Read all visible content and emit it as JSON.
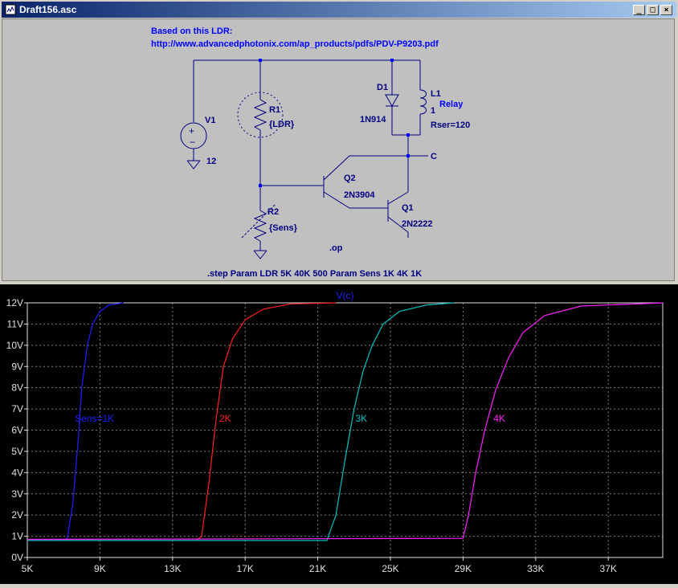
{
  "window": {
    "title": "Draft156.asc",
    "buttons": [
      "_",
      "□",
      "×"
    ]
  },
  "schematic": {
    "comment1": "Based on this LDR:",
    "comment2": "http://www.advancedphotonix.com/ap_products/pdfs/PDV-P9203.pdf",
    "v1": {
      "name": "V1",
      "value": "12"
    },
    "r1": {
      "name": "R1",
      "value": "{LDR}"
    },
    "r2": {
      "name": "R2",
      "value": "{Sens}"
    },
    "d1": {
      "name": "D1",
      "value": "1N914"
    },
    "l1": {
      "name": "L1",
      "value": "1",
      "label": "Relay",
      "rser": "Rser=120"
    },
    "q2": {
      "name": "Q2",
      "value": "2N3904"
    },
    "q1": {
      "name": "Q1",
      "value": "2N2222"
    },
    "net": "C",
    "op": ".op",
    "step": ".step Param LDR 5K 40K 500 Param Sens 1K 4K 1K"
  },
  "chart_data": {
    "type": "line",
    "title": "V(c)",
    "xlabel": "",
    "ylabel": "",
    "xlim": [
      5,
      40
    ],
    "ylim": [
      0,
      12
    ],
    "x_ticks": [
      "5K",
      "9K",
      "13K",
      "17K",
      "21K",
      "25K",
      "29K",
      "33K",
      "37K"
    ],
    "y_ticks": [
      "0V",
      "1V",
      "2V",
      "3V",
      "4V",
      "5V",
      "6V",
      "7V",
      "8V",
      "9V",
      "10V",
      "11V",
      "12V"
    ],
    "grid": true,
    "series": [
      {
        "name": "Sens=1K",
        "color": "#2020ff",
        "x": [
          5,
          7,
          7.2,
          7.5,
          7.8,
          8.0,
          8.3,
          8.6,
          9.0,
          9.5,
          10.3
        ],
        "y": [
          0.8,
          0.8,
          0.9,
          2.5,
          5.5,
          8.0,
          10.0,
          11.0,
          11.6,
          11.9,
          12.0
        ]
      },
      {
        "name": "2K",
        "color": "#ff2020",
        "x": [
          5,
          14.3,
          14.6,
          15.0,
          15.4,
          15.8,
          16.3,
          17.0,
          18.0,
          19.5,
          22.0
        ],
        "y": [
          0.8,
          0.8,
          1.0,
          3.5,
          6.5,
          9.0,
          10.3,
          11.2,
          11.7,
          11.95,
          12.0
        ]
      },
      {
        "name": "3K",
        "color": "#00c0c0",
        "x": [
          5,
          21.5,
          22.0,
          22.5,
          23.0,
          23.5,
          24.0,
          24.6,
          25.5,
          27.0,
          28.5
        ],
        "y": [
          0.8,
          0.8,
          2.0,
          4.6,
          7.0,
          8.8,
          10.0,
          11.0,
          11.6,
          11.9,
          12.0
        ]
      },
      {
        "name": "4K",
        "color": "#ff20ff",
        "x": [
          5,
          29.0,
          29.3,
          29.7,
          30.2,
          30.8,
          31.5,
          32.3,
          33.5,
          35.5,
          40.0
        ],
        "y": [
          0.85,
          0.9,
          2.0,
          4.0,
          6.0,
          7.9,
          9.4,
          10.6,
          11.4,
          11.85,
          12.0
        ]
      }
    ],
    "annotations": [
      {
        "text": "Sens=1K",
        "color": "#2020ff",
        "x": 8.7,
        "y": 6.4
      },
      {
        "text": "2K",
        "color": "#ff2020",
        "x": 15.9,
        "y": 6.4
      },
      {
        "text": "3K",
        "color": "#00c0c0",
        "x": 23.4,
        "y": 6.4
      },
      {
        "text": "4K",
        "color": "#ff20ff",
        "x": 31.0,
        "y": 6.4
      }
    ],
    "colors": {
      "background": "#000000",
      "axis": "#e0e0e0",
      "grid": "#808080",
      "title": "#2020ff"
    }
  }
}
